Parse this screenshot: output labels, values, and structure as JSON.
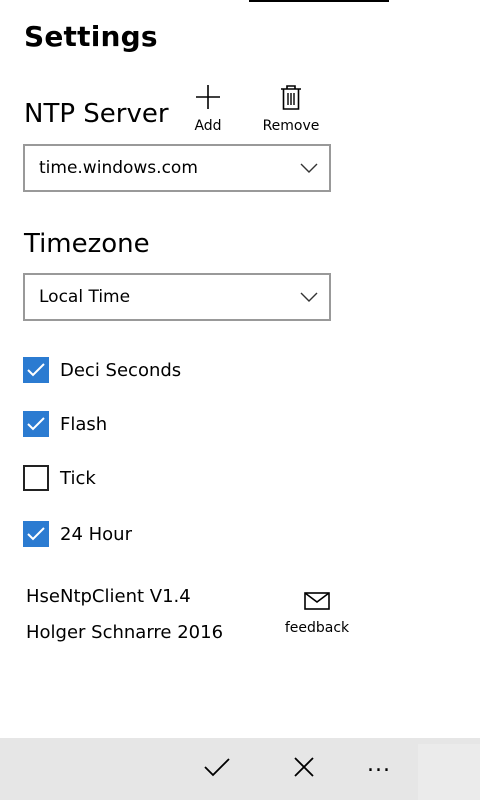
{
  "page": {
    "title": "Settings"
  },
  "ntp": {
    "label": "NTP Server",
    "add_label": "Add",
    "remove_label": "Remove",
    "server_value": "time.windows.com"
  },
  "timezone": {
    "label": "Timezone",
    "value": "Local Time"
  },
  "options": [
    {
      "label": "Deci Seconds",
      "checked": true
    },
    {
      "label": "Flash",
      "checked": true
    },
    {
      "label": "Tick",
      "checked": false
    },
    {
      "label": "24 Hour",
      "checked": true
    }
  ],
  "about": {
    "version": "HseNtpClient V1.4",
    "author": "Holger Schnarre 2016",
    "feedback_label": "feedback"
  },
  "app_bar": {
    "accept_icon": "checkmark-icon",
    "cancel_icon": "close-icon",
    "more_label": "..."
  },
  "colors": {
    "accent": "#2b7bd1",
    "app_bar_bg": "#e6e6e6",
    "dropdown_border": "#999999"
  }
}
